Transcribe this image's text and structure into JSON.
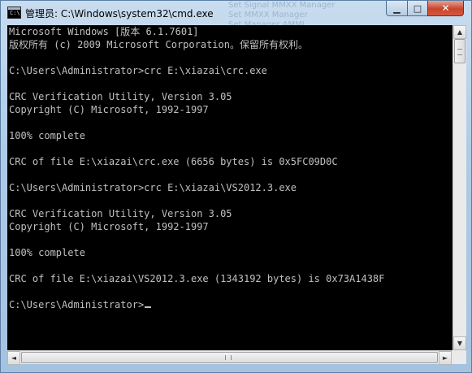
{
  "window": {
    "title": "管理员: C:\\Windows\\system32\\cmd.exe",
    "icon_label": "C:\\",
    "background_text": [
      "Set Signal MMXX Manager",
      "Set MMXX Manager",
      "Set Manager AMMI"
    ],
    "controls": {
      "minimize": "▁",
      "maximize": "□",
      "close": "✕"
    }
  },
  "console": {
    "lines": [
      "Microsoft Windows [版本 6.1.7601]",
      "版权所有 (c) 2009 Microsoft Corporation。保留所有权利。",
      "",
      "C:\\Users\\Administrator>crc E:\\xiazai\\crc.exe",
      "",
      "CRC Verification Utility, Version 3.05",
      "Copyright (C) Microsoft, 1992-1997",
      "",
      "100% complete",
      "",
      "CRC of file E:\\xiazai\\crc.exe (6656 bytes) is 0x5FC09D0C",
      "",
      "C:\\Users\\Administrator>crc E:\\xiazai\\VS2012.3.exe",
      "",
      "CRC Verification Utility, Version 3.05",
      "Copyright (C) Microsoft, 1992-1997",
      "",
      "100% complete",
      "",
      "CRC of file E:\\xiazai\\VS2012.3.exe (1343192 bytes) is 0x73A1438F",
      "",
      "C:\\Users\\Administrator>"
    ],
    "text_color": "#c0c0c0",
    "background_color": "#000000"
  },
  "scrollbar": {
    "up": "▲",
    "down": "▼",
    "left": "◄",
    "right": "►"
  }
}
